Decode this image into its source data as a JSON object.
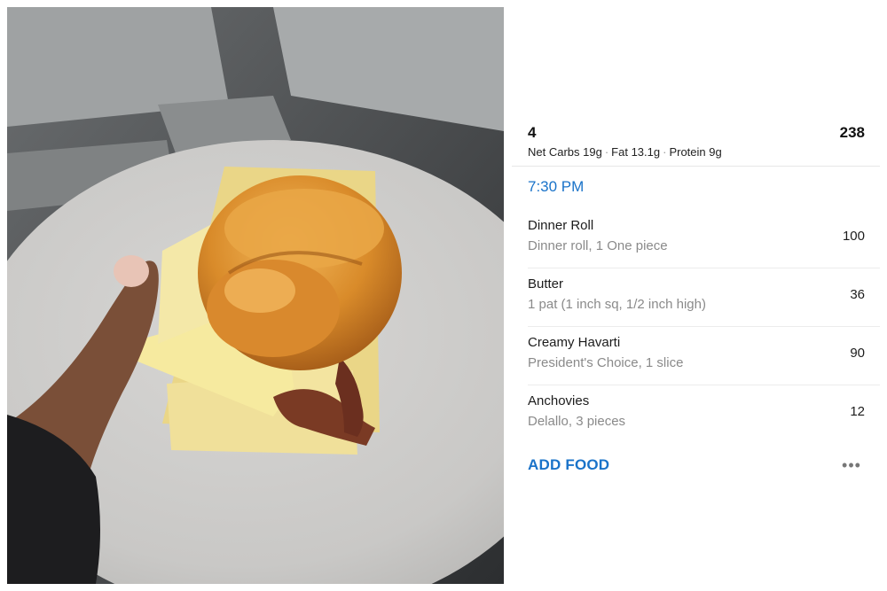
{
  "meal": {
    "name": "4",
    "total_calories": "238",
    "macros": {
      "net_carbs": "Net Carbs 19g",
      "fat": "Fat 13.1g",
      "protein": "Protein 9g",
      "separator": "·"
    },
    "time": "7:30 PM",
    "entries": [
      {
        "name": "Dinner Roll",
        "description": "Dinner roll, 1 One piece",
        "calories": "100"
      },
      {
        "name": "Butter",
        "description": "1 pat (1 inch sq, 1/2 inch high)",
        "calories": "36"
      },
      {
        "name": "Creamy Havarti",
        "description": "President's Choice, 1 slice",
        "calories": "90"
      },
      {
        "name": "Anchovies",
        "description": "Delallo, 3 pieces",
        "calories": "12"
      }
    ],
    "add_food_label": "ADD FOOD",
    "more_icon": "more-horizontal-icon",
    "more_glyph": "•••"
  },
  "colors": {
    "accent": "#1a73c9",
    "secondary_text": "#8a8a8a",
    "primary_text": "#1c1c1c"
  }
}
